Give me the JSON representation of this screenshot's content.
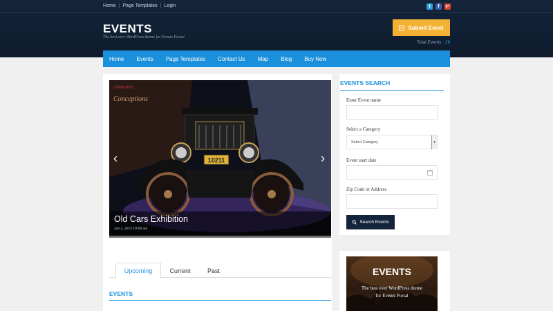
{
  "topbar": {
    "links": [
      "Home",
      "Page Templates",
      "Login"
    ],
    "social": [
      "twitter-icon",
      "facebook-icon",
      "googleplus-icon"
    ]
  },
  "brand": {
    "title": "EVENTS",
    "tagline": "The best ever WordPress theme for Events Portal"
  },
  "submit": {
    "label": "Submit Event"
  },
  "total": {
    "label": "Total Events :",
    "value": "29"
  },
  "nav": {
    "items": [
      "Home",
      "Events",
      "Page Templates",
      "Contact Us",
      "Map",
      "Blog",
      "Buy Now"
    ]
  },
  "slider": {
    "title": "Old Cars Exhibition",
    "date": "Jan 2, 2013 10:00 am",
    "plate": "10211"
  },
  "tabs": [
    "Upcoming",
    "Current",
    "Past"
  ],
  "events_heading": "EVENTS",
  "search": {
    "title": "EVENTS SEARCH",
    "name_label": "Enter Event name",
    "category_label": "Select a Category",
    "category_value": "Select Category",
    "date_label": "Event start date",
    "zip_label": "Zip Code or Address",
    "button": "Search Events"
  },
  "promo": {
    "title": "EVENTS",
    "subtitle_line1": "The best ever WordPress theme",
    "subtitle_line2": "for Events Portal"
  },
  "colors": {
    "header_bg": "#14243a",
    "accent_blue": "#1a90dc",
    "submit_orange": "#f3b233"
  }
}
